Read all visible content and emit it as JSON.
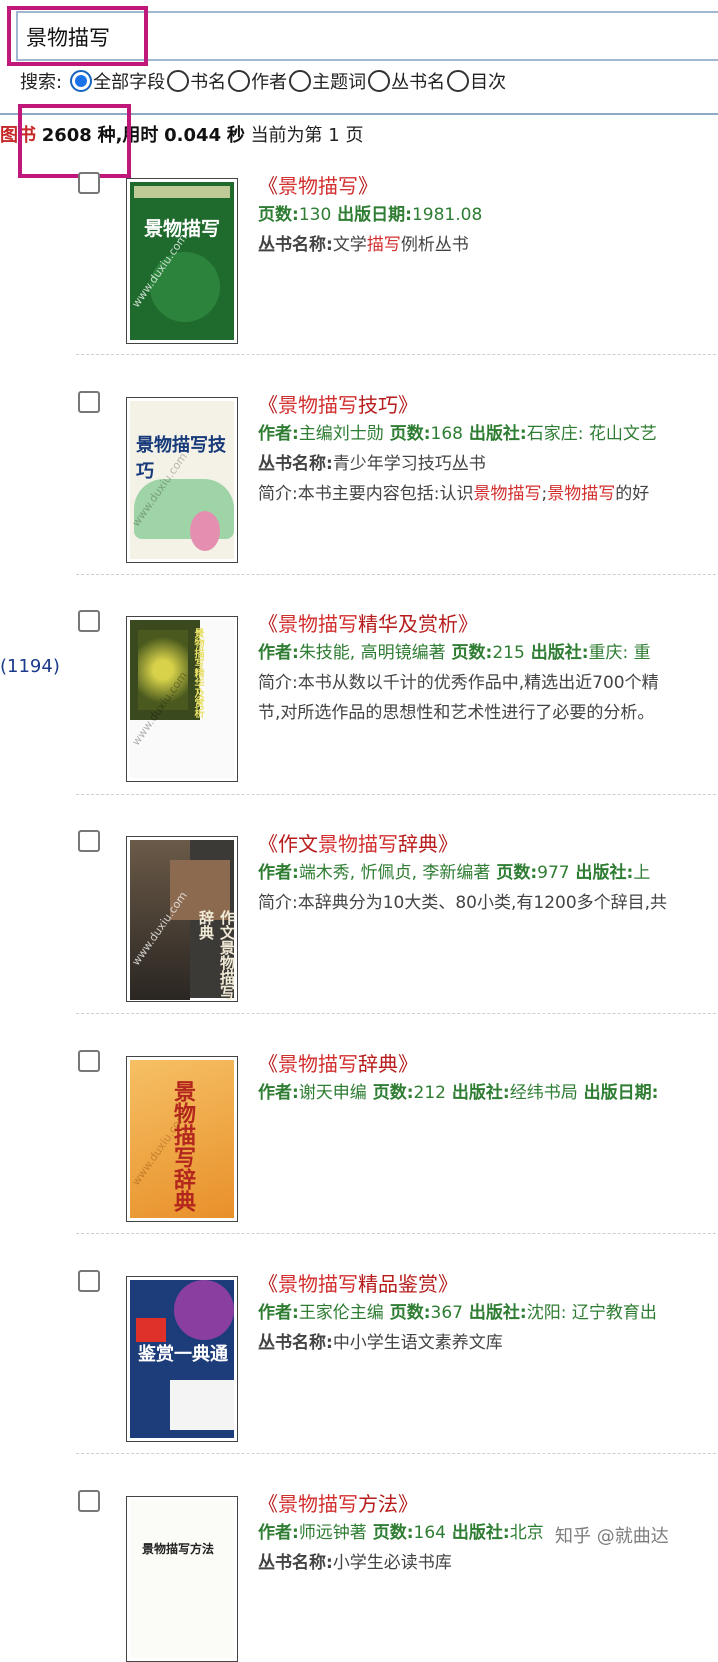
{
  "search": {
    "query": "景物描写"
  },
  "scope": {
    "label": "搜索:",
    "options": [
      "全部字段",
      "书名",
      "作者",
      "主题词",
      "丛书名",
      "目次"
    ],
    "selected": 0
  },
  "stats": {
    "prefix": "图书",
    "count": "2608",
    "unit": "种,",
    "time_label": "用时",
    "time": "0.044",
    "sec": "秒",
    "page_text": "当前为第 1 页"
  },
  "facet": {
    "count": "(1194)"
  },
  "books": [
    {
      "title_pre": "《",
      "title_kw": "景物描写",
      "title_rest": "",
      "title_post": "》",
      "line1": {
        "key1": "页数:",
        "val1": "130",
        "key2": " 出版日期:",
        "val2": "1981.08"
      },
      "line2": {
        "key": "丛书名称:",
        "t1": "文学",
        "kw": "描写",
        "t2": "例析丛书"
      },
      "cover": {
        "bg": "#1f6b2e",
        "title": "景物描写",
        "color": "#ffffff"
      }
    },
    {
      "title_pre": "《",
      "title_kw": "景物描写",
      "title_rest": "技巧",
      "title_post": "》",
      "line1": {
        "key1": "作者:",
        "val1": "主编刘士勋",
        "key2": " 页数:",
        "val2": "168",
        "key3": " 出版社:",
        "val3": "石家庄: 花山文艺"
      },
      "line2": {
        "key": "丛书名称:",
        "t1": "青少年学习技巧丛书"
      },
      "line3": {
        "t1": "简介:本书主要内容包括:认识",
        "kw1": "景物描写",
        "t2": ";",
        "kw2": "景物描写",
        "t3": "的好"
      },
      "cover": {
        "bg": "#f4f1e6",
        "title": "景物描写技巧",
        "color": "#163a7a"
      }
    },
    {
      "title_pre": "《",
      "title_kw": "景物描写",
      "title_rest": "精华及赏析",
      "title_post": "》",
      "line1": {
        "key1": "作者:",
        "val1": "朱技能, 高明镜编著",
        "key2": " 页数:",
        "val2": "215",
        "key3": " 出版社:",
        "val3": "重庆: 重"
      },
      "line2": {
        "t1": "简介:本书从数以千计的优秀作品中,精选出近700个精"
      },
      "line3": {
        "t1": "节,对所选作品的思想性和艺术性进行了必要的分析。"
      },
      "cover": {
        "bg": "#fafafa",
        "title": "景物描写精华及赏析",
        "color": "#e8e066"
      }
    },
    {
      "title_pre": "《作文",
      "title_kw": "景物描写",
      "title_rest": "辞典",
      "title_post": "》",
      "line1": {
        "key1": "作者:",
        "val1": "端木秀, 忻佩贞, 李新编著",
        "key2": " 页数:",
        "val2": "977",
        "key3": " 出版社:",
        "val3": "上"
      },
      "line2": {
        "t1": "简介:本辞典分为10大类、80小类,有1200多个辞目,共"
      },
      "cover": {
        "bg": "#3c3a36",
        "title": "作文景物描写辞典",
        "color": "#f0ead6"
      }
    },
    {
      "title_pre": "《",
      "title_kw": "景物描写",
      "title_rest": "辞典",
      "title_post": "》",
      "line1": {
        "key1": "作者:",
        "val1": "谢天申编",
        "key2": " 页数:",
        "val2": "212",
        "key3": " 出版社:",
        "val3": "经纬书局",
        "key4": " 出版日期:"
      },
      "cover": {
        "bg": "#f2a53a",
        "title": "景物描写辞典",
        "color": "#b3261e"
      }
    },
    {
      "title_pre": "《",
      "title_kw": "景物描写",
      "title_rest": "精品鉴赏",
      "title_post": "》",
      "line1": {
        "key1": "作者:",
        "val1": "王家伦主编",
        "key2": " 页数:",
        "val2": "367",
        "key3": " 出版社:",
        "val3": "沈阳: 辽宁教育出"
      },
      "line2": {
        "key": "丛书名称:",
        "t1": "中小学生语文素养文库"
      },
      "cover": {
        "bg": "#1d3c7a",
        "title": "鉴赏一典通",
        "color": "#ffffff"
      }
    },
    {
      "title_pre": "《",
      "title_kw": "景物描写",
      "title_rest": "方法",
      "title_post": "》",
      "line1": {
        "key1": "作者:",
        "val1": "师远钟著",
        "key2": " 页数:",
        "val2": "164",
        "key3": " 出版社:",
        "val3": "北京"
      },
      "line2": {
        "key": "丛书名称:",
        "t1": "小学生必读书库"
      },
      "cover": {
        "bg": "#fbfbf7",
        "title": "景物描写方法",
        "color": "#222222"
      }
    }
  ],
  "watermark": "知乎 @就曲达"
}
